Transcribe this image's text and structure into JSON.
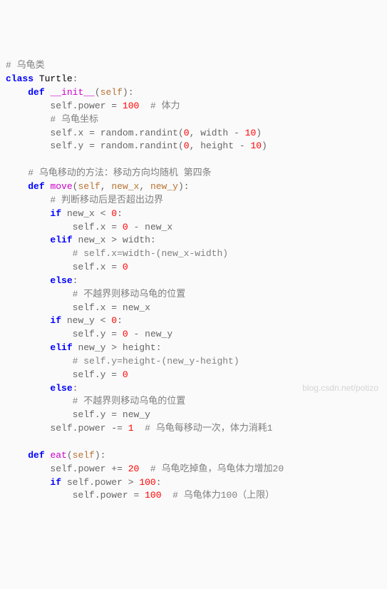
{
  "c1": "# 乌龟类",
  "kw_class": "class",
  "cls_name": "Turtle",
  "kw_def": "def",
  "fn_init": "__init__",
  "slf": "self",
  "c_power": "# 体力",
  "c_coord": "# 乌龟坐标",
  "v_x": "x",
  "v_y": "y",
  "id_random": "random",
  "id_randint": "randint",
  "n0": "0",
  "n1": "1",
  "n10": "10",
  "n20": "20",
  "n100": "100",
  "id_width": "width",
  "id_height": "height",
  "c_move": "# 乌龟移动的方法：移动方向均随机 第四条",
  "fn_move": "move",
  "p_newx": "new_x",
  "p_newy": "new_y",
  "c_bound": "# 判断移动后是否超出边界",
  "kw_if": "if",
  "kw_elif": "elif",
  "kw_else": "else",
  "c_xw": "# self.x=width-(new_x-width)",
  "c_nobound": "# 不越界则移动乌龟的位置",
  "c_yh": "# self.y=height-(new_y-height)",
  "v_power": "power",
  "c_consume": "# 乌龟每移动一次，体力消耗1",
  "fn_eat": "eat",
  "c_eat20": "# 乌龟吃掉鱼，乌龟体力增加20",
  "c_cap": "# 乌龟体力100（上限）",
  "watermark": "blog.csdn.net/potizo"
}
